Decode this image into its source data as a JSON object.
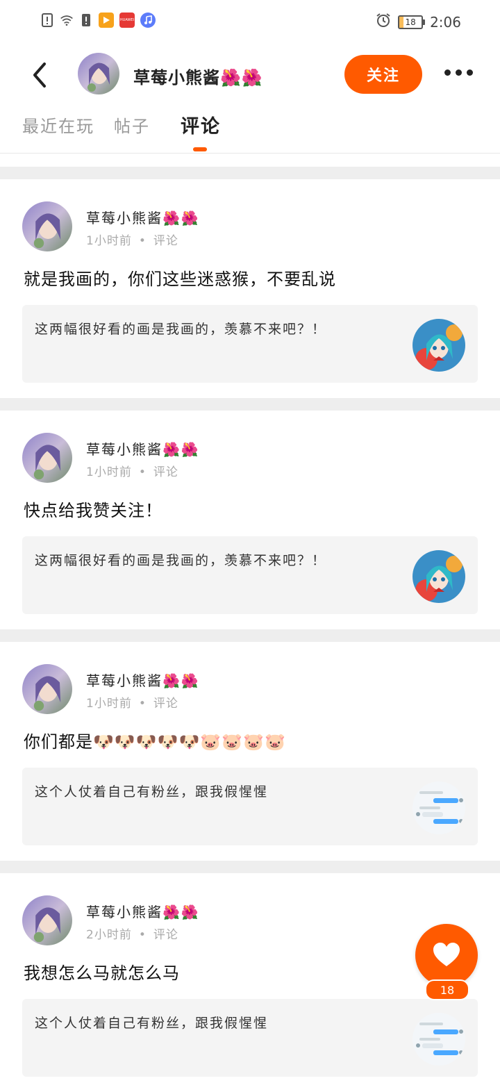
{
  "status_bar": {
    "time": "2:06",
    "battery": "18",
    "battery_level": 0.18,
    "left_icons": [
      "alert-icon",
      "wifi-icon",
      "sim-alert-icon",
      "video-app-icon",
      "huawei-app-icon",
      "music-app-icon"
    ],
    "huawei_label": "HUAWEI",
    "right_icons": [
      "alarm-icon",
      "battery-icon"
    ]
  },
  "header": {
    "username": "草莓小熊酱🌺🌺",
    "follow_label": "关注",
    "back_icon": "chevron-left-icon",
    "more_icon": "more-icon"
  },
  "tabs": [
    {
      "label": "最近在玩"
    },
    {
      "label": "帖子"
    },
    {
      "label": "评论",
      "active": true
    }
  ],
  "comments": [
    {
      "author": "草莓小熊酱🌺🌺",
      "time": "1小时前",
      "type": "评论",
      "text": "就是我画的，你们这些迷惑猴，不要乱说",
      "quote": {
        "text": "这两幅很好看的画是我画的，羡慕不来吧？！",
        "thumb": "anime-girl-image"
      }
    },
    {
      "author": "草莓小熊酱🌺🌺",
      "time": "1小时前",
      "type": "评论",
      "text": "快点给我赞关注！",
      "quote": {
        "text": "这两幅很好看的画是我画的，羡慕不来吧？！",
        "thumb": "anime-girl-image"
      }
    },
    {
      "author": "草莓小熊酱🌺🌺",
      "time": "1小时前",
      "type": "评论",
      "text": "你们都是🐶🐶🐶🐶🐶🐷🐷🐷🐷",
      "quote": {
        "text": "这个人仗着自己有粉丝，跟我假惺惺",
        "thumb": "chat-screenshot-image"
      }
    },
    {
      "author": "草莓小熊酱🌺🌺",
      "time": "2小时前",
      "type": "评论",
      "text": "我想怎么马就怎么马",
      "quote": {
        "text": "这个人仗着自己有粉丝，跟我假惺惺",
        "thumb": "chat-screenshot-image"
      }
    }
  ],
  "like_fab": {
    "count": "18",
    "icon": "heart-icon"
  },
  "colors": {
    "accent": "#ff5a00",
    "separator": "#eeeeee",
    "quote_bg": "#f4f4f4"
  }
}
